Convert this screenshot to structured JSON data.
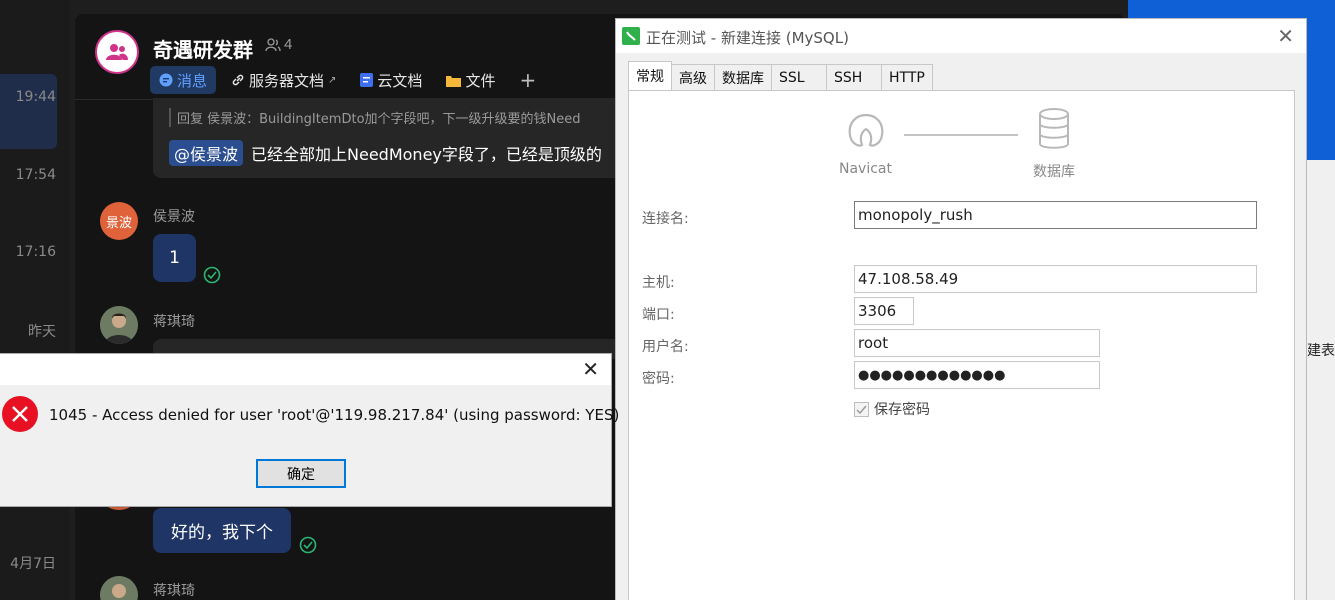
{
  "sidebar_times": [
    "19:44",
    "17:54",
    "17:16",
    "昨天",
    "4月7日"
  ],
  "chat": {
    "group_name": "奇遇研发群",
    "member_count": "4",
    "tabs": [
      "消息",
      "服务器文档",
      "云文档",
      "文件"
    ],
    "add_tab": "+",
    "reply": {
      "quote": "回复 侯景波：BuildingItemDto加个字段吧，下一级升级要的钱Need",
      "mention": "@侯景波",
      "text": "已经全部加上NeedMoney字段了，已经是顶级的"
    },
    "messages": [
      {
        "sender": "侯景波",
        "avatar_text": "景波",
        "text": "1"
      },
      {
        "sender": "蒋琪琦"
      },
      {
        "text": "好的，我下个"
      },
      {
        "sender": "蒋琪琦"
      }
    ]
  },
  "navicat": {
    "title": "正在测试 - 新建连接 (MySQL)",
    "tabs": [
      "常规",
      "高级",
      "数据库",
      "SSL",
      "SSH",
      "HTTP"
    ],
    "diagram": {
      "left_label": "Navicat",
      "right_label": "数据库"
    },
    "fields": {
      "connection_name": {
        "label": "连接名:",
        "value": "monopoly_rush"
      },
      "host": {
        "label": "主机:",
        "value": "47.108.58.49"
      },
      "port": {
        "label": "端口:",
        "value": "3306"
      },
      "username": {
        "label": "用户名:",
        "value": "root"
      },
      "password": {
        "label": "密码:",
        "value": "●●●●●●●●●●●●●"
      }
    },
    "save_password_label": "保存密码"
  },
  "error_dialog": {
    "message": "1045 - Access denied for user 'root'@'119.98.217.84' (using password: YES)",
    "ok_label": "确定"
  },
  "right_fragment": "建表",
  "colors": {
    "accent_blue": "#0f5fd6",
    "error_red": "#e81123",
    "navicat_green": "#2fb04a",
    "mention_blue": "#2a4e90"
  }
}
